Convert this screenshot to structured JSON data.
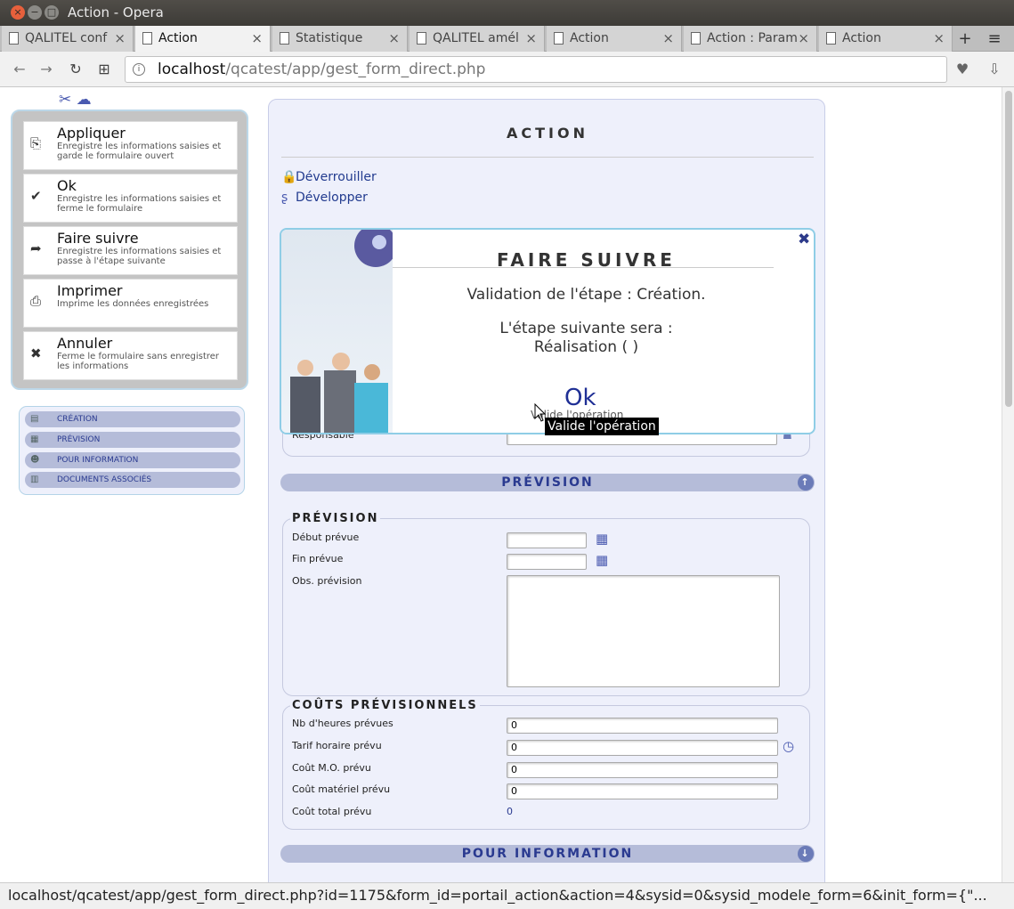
{
  "window": {
    "title": "Action - Opera",
    "close": "×",
    "min": "−",
    "max": "□"
  },
  "tabs": [
    {
      "label": "QALITEL conf",
      "close": "×"
    },
    {
      "label": "Action",
      "close": "×"
    },
    {
      "label": "Statistique",
      "close": "×"
    },
    {
      "label": "QALITEL amél",
      "close": "×"
    },
    {
      "label": "Action",
      "close": "×"
    },
    {
      "label": "Action : Param",
      "close": "×"
    },
    {
      "label": "Action",
      "close": "×"
    }
  ],
  "tabbar": {
    "new_tab": "+",
    "menu": "≡"
  },
  "nav": {
    "back": "←",
    "forward": "→",
    "reload": "↻",
    "grid": "⊞",
    "url_host": "localhost",
    "url_path": "/qcatest/app/gest_form_direct.php",
    "heart": "♥",
    "download": "⇩"
  },
  "toolbar_icons": "✂ ☁",
  "actions": [
    {
      "label": "Appliquer",
      "desc": "Enregistre les informations saisies et garde le formulaire ouvert",
      "icon": "⎘"
    },
    {
      "label": "Ok",
      "desc": "Enregistre les informations saisies et ferme le formulaire",
      "icon": "✔"
    },
    {
      "label": "Faire suivre",
      "desc": "Enregistre les informations saisies et passe à l'étape suivante",
      "icon": "➦"
    },
    {
      "label": "Imprimer",
      "desc": "Imprime les données enregistrées",
      "icon": "⎙"
    },
    {
      "label": "Annuler",
      "desc": "Ferme le formulaire sans enregistrer les informations",
      "icon": "✖"
    }
  ],
  "steps": [
    {
      "label": "CRÉATION",
      "icon": "▤"
    },
    {
      "label": "PRÉVISION",
      "icon": "▦"
    },
    {
      "label": "POUR INFORMATION",
      "icon": "☻"
    },
    {
      "label": "DOCUMENTS ASSOCIÉS",
      "icon": "▥"
    }
  ],
  "form": {
    "title": "ACTION",
    "unlock": "Déverrouiller",
    "unlock_icon": "🔒",
    "expand": "Développer",
    "expand_icon": "ʂ",
    "responsable_label": "Responsable",
    "section_prevision": "PRÉVISION",
    "section_info": "POUR INFORMATION",
    "band_icon": "↑",
    "band_icon2": "↓",
    "prev_legend": "PRÉVISION",
    "debut_label": "Début prévue",
    "fin_label": "Fin prévue",
    "obs_label": "Obs. prévision",
    "cal_icon": "▦",
    "couts_legend": "COÛTS PRÉVISIONNELS",
    "heures_label": "Nb d'heures prévues",
    "heures_value": "0",
    "tarif_label": "Tarif horaire prévu",
    "tarif_value": "0",
    "clock_icon": "◷",
    "mo_label": "Coût M.O. prévu",
    "mo_value": "0",
    "mat_label": "Coût matériel prévu",
    "mat_value": "0",
    "total_label": "Coût total prévu",
    "total_value": "0"
  },
  "modal": {
    "title": "FAIRE SUIVRE",
    "close": "✖",
    "line1": "Validation de l'étape : Création.",
    "line2": "L'étape suivante sera :",
    "line3": "Réalisation ( )",
    "ok": "Ok",
    "ok_sub": "Valide l'opération",
    "tooltip": "Valide l'opération"
  },
  "status_url": "localhost/qcatest/app/gest_form_direct.php?id=1175&form_id=portail_action&action=4&sysid=0&sysid_modele_form=6&init_form={\"..."
}
